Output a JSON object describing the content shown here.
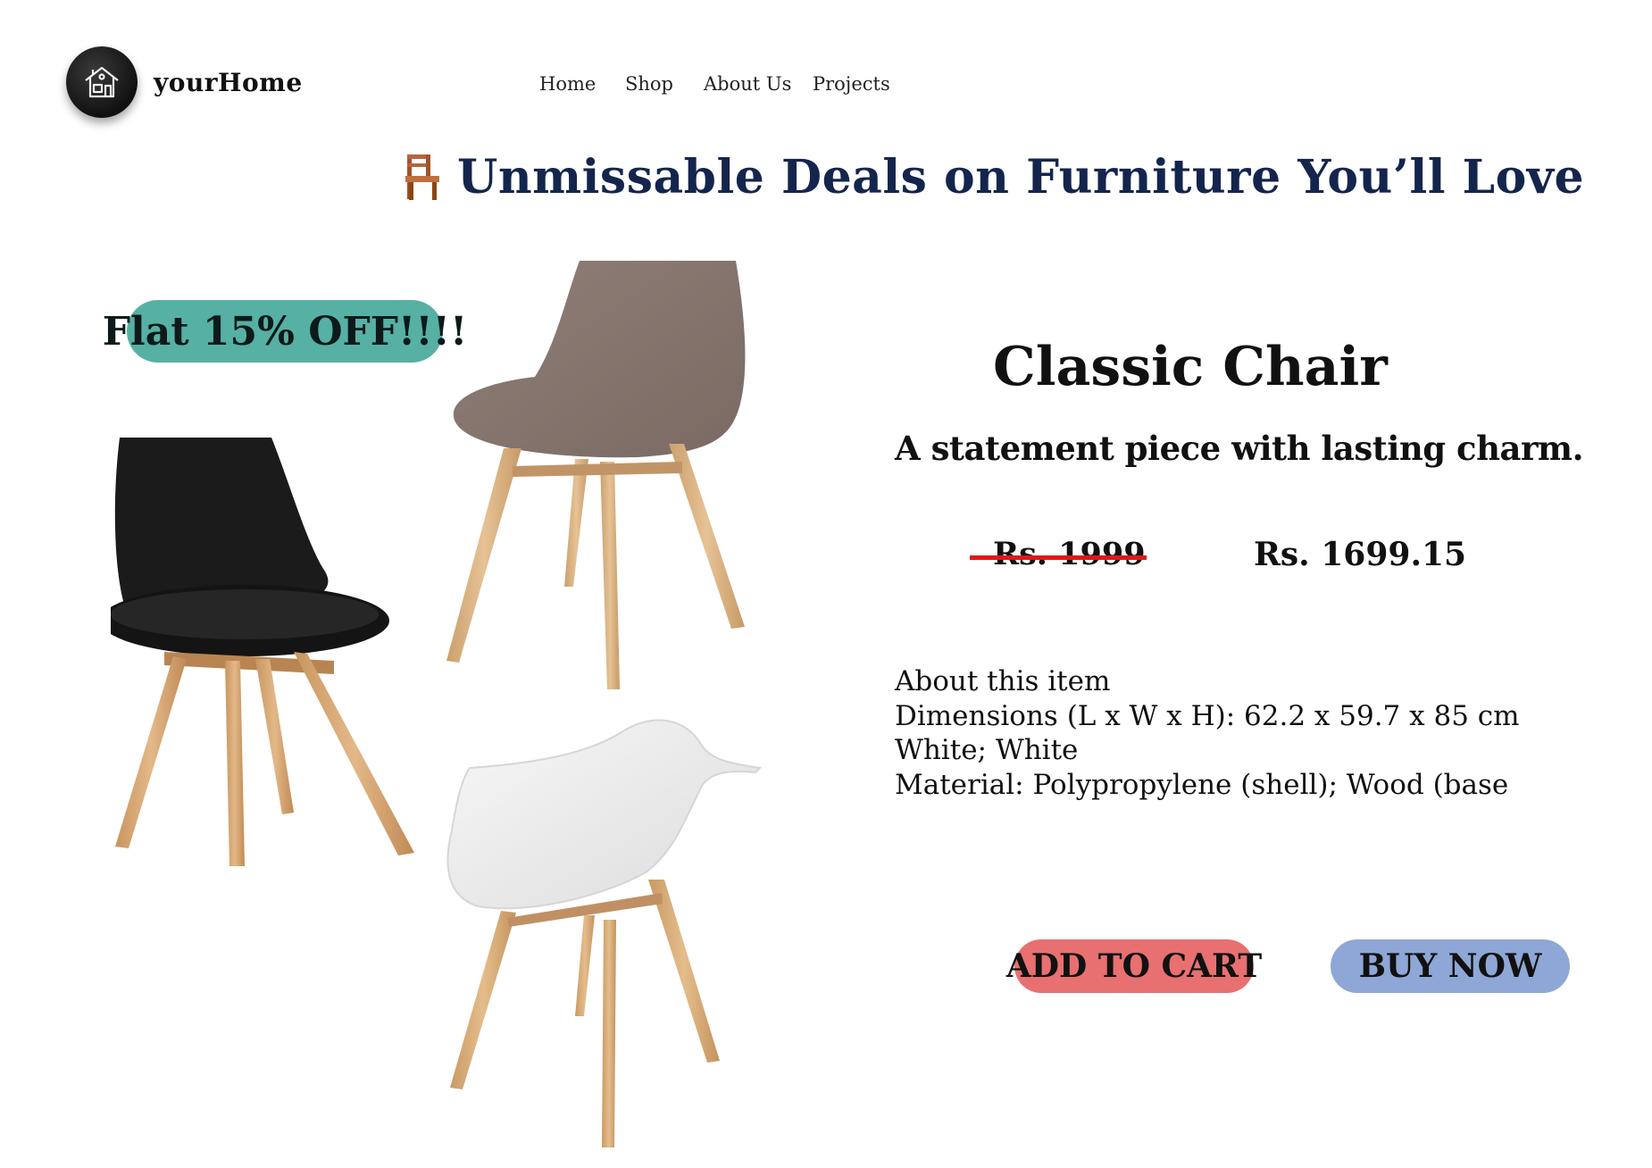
{
  "header": {
    "logo_icon": "house-icon",
    "brand_name": "yourHome",
    "nav": [
      "Home",
      "Shop",
      "About Us",
      "Projects"
    ]
  },
  "hero": {
    "headline_icon": "chair-emoji-icon",
    "headline": "Unmissable Deals on Furniture You’ll Love"
  },
  "gallery": {
    "badge": "Flat 15% OFF!!!!",
    "images": [
      "black-chair",
      "taupe-chair",
      "white-armchair"
    ]
  },
  "product": {
    "title": "Classic Chair",
    "tagline": "A statement piece with lasting charm.",
    "old_price": "Rs. 1999",
    "new_price": "Rs. 1699.15",
    "about_heading": "About this item",
    "details": [
      "Dimensions (L x W x H): 62.2 x 59.7 x 85 cm",
      "White; White",
      "Material: Polypropylene (shell); Wood (base"
    ]
  },
  "actions": {
    "add_to_cart": "ADD TO CART",
    "buy_now": "BUY NOW"
  },
  "colors": {
    "headline": "#14254d",
    "badge": "#57b0a4",
    "add_to_cart": "#e87070",
    "buy_now": "#8ea7d6",
    "strike": "#e01818"
  }
}
